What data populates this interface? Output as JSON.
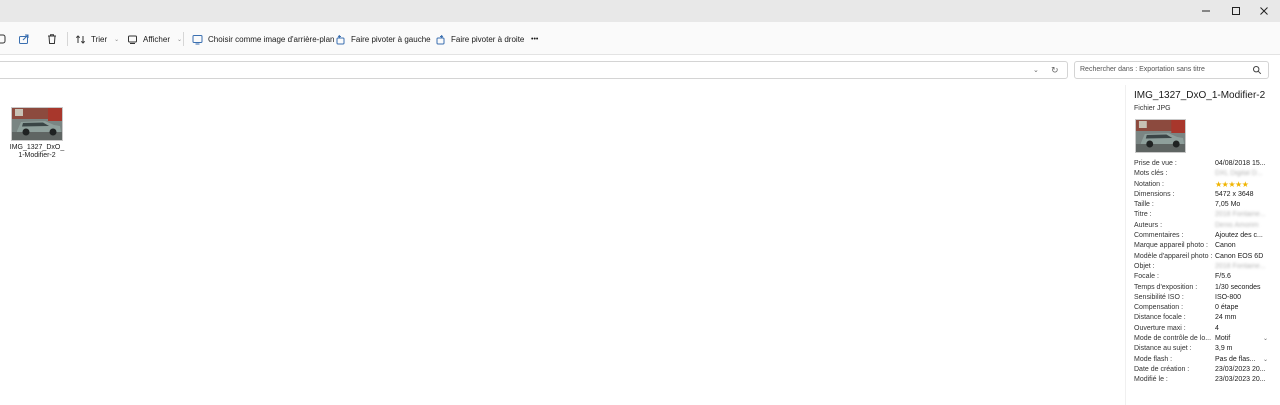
{
  "window": {
    "controls": [
      "minimize",
      "maximize",
      "close"
    ]
  },
  "toolbar": {
    "sort_label": "Trier",
    "view_label": "Afficher",
    "set_background_label": "Choisir comme image d'arrière-plan",
    "rotate_left_label": "Faire pivoter à gauche",
    "rotate_right_label": "Faire pivoter à droite",
    "more_label": "•••"
  },
  "search": {
    "placeholder": "Rechercher dans : Exportation sans titre"
  },
  "files": [
    {
      "name": "IMG_1327_DxO_1-Modifier-2"
    }
  ],
  "details": {
    "title": "IMG_1327_DxO_1-Modifier-2",
    "type": "Fichier JPG",
    "properties": [
      {
        "label": "Prise de vue :",
        "value": "04/08/2018 15..."
      },
      {
        "label": "Mots clés :",
        "value": "DXL Digital D...",
        "blurred": true
      },
      {
        "label": "Notation :",
        "value": "★★★★★",
        "stars": 5
      },
      {
        "label": "Dimensions :",
        "value": "5472 x 3648"
      },
      {
        "label": "Taille :",
        "value": "7,05 Mo"
      },
      {
        "label": "Titre :",
        "value": "2018 Fontaine...",
        "blurred": true
      },
      {
        "label": "Auteurs :",
        "value": "Denis Amorim",
        "blurred": true
      },
      {
        "label": "Commentaires :",
        "value": "Ajoutez des c..."
      },
      {
        "label": "Marque appareil photo :",
        "value": "Canon"
      },
      {
        "label": "Modèle d'appareil photo :",
        "value": "Canon EOS 6D"
      },
      {
        "label": "Objet :",
        "value": "2018 Fontaine...",
        "blurred": true
      },
      {
        "label": "Focale :",
        "value": "F/5.6"
      },
      {
        "label": "Temps d'exposition :",
        "value": "1/30 secondes"
      },
      {
        "label": "Sensibilité ISO :",
        "value": "ISO-800"
      },
      {
        "label": "Compensation :",
        "value": "0 étape"
      },
      {
        "label": "Distance focale :",
        "value": "24 mm"
      },
      {
        "label": "Ouverture maxi :",
        "value": "4"
      },
      {
        "label": "Mode de contrôle de lo...",
        "value": "Motif",
        "dropdown": true
      },
      {
        "label": "Distance au sujet :",
        "value": "3,9 m"
      },
      {
        "label": "Mode flash :",
        "value": "Pas de flas...",
        "dropdown": true
      },
      {
        "label": "Date de création :",
        "value": "23/03/2023 20..."
      },
      {
        "label": "Modifié le :",
        "value": "23/03/2023 20..."
      }
    ]
  }
}
